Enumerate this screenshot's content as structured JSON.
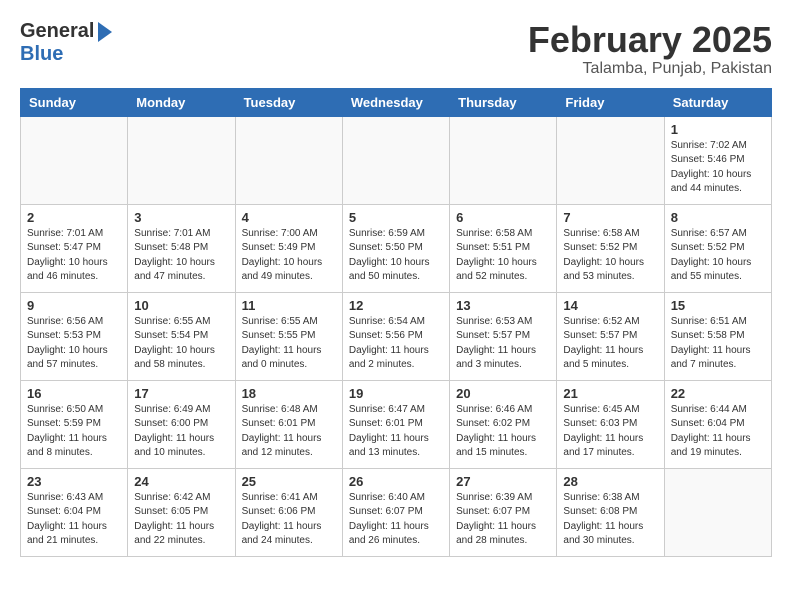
{
  "header": {
    "logo_general": "General",
    "logo_blue": "Blue",
    "month_year": "February 2025",
    "location": "Talamba, Punjab, Pakistan"
  },
  "weekdays": [
    "Sunday",
    "Monday",
    "Tuesday",
    "Wednesday",
    "Thursday",
    "Friday",
    "Saturday"
  ],
  "weeks": [
    [
      {
        "day": "",
        "info": ""
      },
      {
        "day": "",
        "info": ""
      },
      {
        "day": "",
        "info": ""
      },
      {
        "day": "",
        "info": ""
      },
      {
        "day": "",
        "info": ""
      },
      {
        "day": "",
        "info": ""
      },
      {
        "day": "1",
        "info": "Sunrise: 7:02 AM\nSunset: 5:46 PM\nDaylight: 10 hours and 44 minutes."
      }
    ],
    [
      {
        "day": "2",
        "info": "Sunrise: 7:01 AM\nSunset: 5:47 PM\nDaylight: 10 hours and 46 minutes."
      },
      {
        "day": "3",
        "info": "Sunrise: 7:01 AM\nSunset: 5:48 PM\nDaylight: 10 hours and 47 minutes."
      },
      {
        "day": "4",
        "info": "Sunrise: 7:00 AM\nSunset: 5:49 PM\nDaylight: 10 hours and 49 minutes."
      },
      {
        "day": "5",
        "info": "Sunrise: 6:59 AM\nSunset: 5:50 PM\nDaylight: 10 hours and 50 minutes."
      },
      {
        "day": "6",
        "info": "Sunrise: 6:58 AM\nSunset: 5:51 PM\nDaylight: 10 hours and 52 minutes."
      },
      {
        "day": "7",
        "info": "Sunrise: 6:58 AM\nSunset: 5:52 PM\nDaylight: 10 hours and 53 minutes."
      },
      {
        "day": "8",
        "info": "Sunrise: 6:57 AM\nSunset: 5:52 PM\nDaylight: 10 hours and 55 minutes."
      }
    ],
    [
      {
        "day": "9",
        "info": "Sunrise: 6:56 AM\nSunset: 5:53 PM\nDaylight: 10 hours and 57 minutes."
      },
      {
        "day": "10",
        "info": "Sunrise: 6:55 AM\nSunset: 5:54 PM\nDaylight: 10 hours and 58 minutes."
      },
      {
        "day": "11",
        "info": "Sunrise: 6:55 AM\nSunset: 5:55 PM\nDaylight: 11 hours and 0 minutes."
      },
      {
        "day": "12",
        "info": "Sunrise: 6:54 AM\nSunset: 5:56 PM\nDaylight: 11 hours and 2 minutes."
      },
      {
        "day": "13",
        "info": "Sunrise: 6:53 AM\nSunset: 5:57 PM\nDaylight: 11 hours and 3 minutes."
      },
      {
        "day": "14",
        "info": "Sunrise: 6:52 AM\nSunset: 5:57 PM\nDaylight: 11 hours and 5 minutes."
      },
      {
        "day": "15",
        "info": "Sunrise: 6:51 AM\nSunset: 5:58 PM\nDaylight: 11 hours and 7 minutes."
      }
    ],
    [
      {
        "day": "16",
        "info": "Sunrise: 6:50 AM\nSunset: 5:59 PM\nDaylight: 11 hours and 8 minutes."
      },
      {
        "day": "17",
        "info": "Sunrise: 6:49 AM\nSunset: 6:00 PM\nDaylight: 11 hours and 10 minutes."
      },
      {
        "day": "18",
        "info": "Sunrise: 6:48 AM\nSunset: 6:01 PM\nDaylight: 11 hours and 12 minutes."
      },
      {
        "day": "19",
        "info": "Sunrise: 6:47 AM\nSunset: 6:01 PM\nDaylight: 11 hours and 13 minutes."
      },
      {
        "day": "20",
        "info": "Sunrise: 6:46 AM\nSunset: 6:02 PM\nDaylight: 11 hours and 15 minutes."
      },
      {
        "day": "21",
        "info": "Sunrise: 6:45 AM\nSunset: 6:03 PM\nDaylight: 11 hours and 17 minutes."
      },
      {
        "day": "22",
        "info": "Sunrise: 6:44 AM\nSunset: 6:04 PM\nDaylight: 11 hours and 19 minutes."
      }
    ],
    [
      {
        "day": "23",
        "info": "Sunrise: 6:43 AM\nSunset: 6:04 PM\nDaylight: 11 hours and 21 minutes."
      },
      {
        "day": "24",
        "info": "Sunrise: 6:42 AM\nSunset: 6:05 PM\nDaylight: 11 hours and 22 minutes."
      },
      {
        "day": "25",
        "info": "Sunrise: 6:41 AM\nSunset: 6:06 PM\nDaylight: 11 hours and 24 minutes."
      },
      {
        "day": "26",
        "info": "Sunrise: 6:40 AM\nSunset: 6:07 PM\nDaylight: 11 hours and 26 minutes."
      },
      {
        "day": "27",
        "info": "Sunrise: 6:39 AM\nSunset: 6:07 PM\nDaylight: 11 hours and 28 minutes."
      },
      {
        "day": "28",
        "info": "Sunrise: 6:38 AM\nSunset: 6:08 PM\nDaylight: 11 hours and 30 minutes."
      },
      {
        "day": "",
        "info": ""
      }
    ]
  ]
}
